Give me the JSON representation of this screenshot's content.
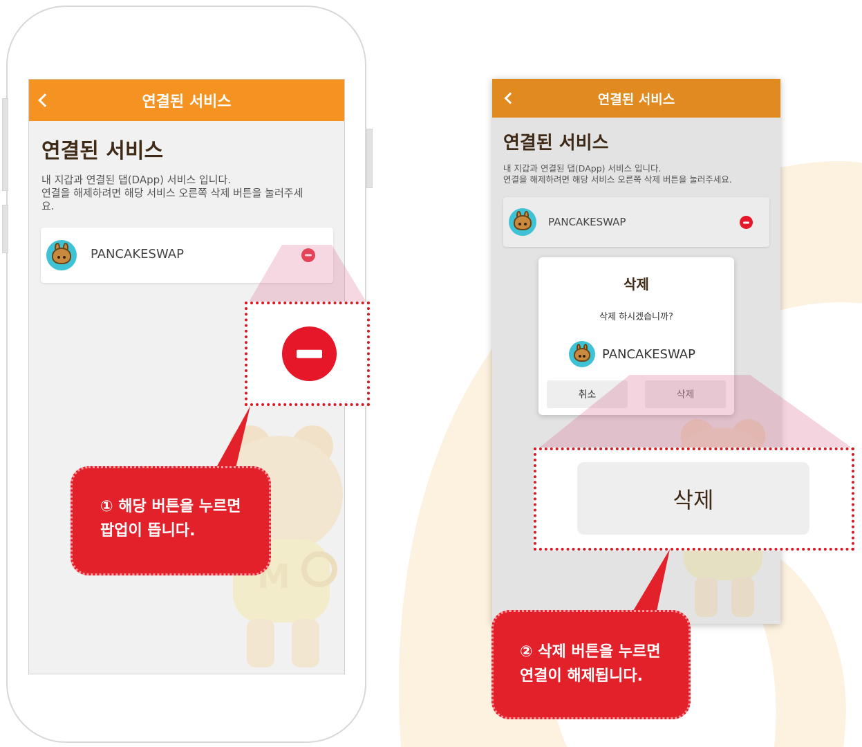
{
  "left_screen": {
    "appbar_title": "연결된 서비스",
    "page_title": "연결된 서비스",
    "description_line1": "내 지갑과 연결된 댑(DApp) 서비스 입니다.",
    "description_line2": "연결을 해제하려면 해당 서비스 오른쪽 삭제 버튼을 눌러주세",
    "description_line3": "요.",
    "service_name": "PANCAKESWAP"
  },
  "right_screen": {
    "appbar_title": "연결된 서비스",
    "page_title": "연결된 서비스",
    "description_line1": "내 지갑과 연결된 댑(DApp) 서비스 입니다.",
    "description_line2": "연결을 해제하려면 해당 서비스 오른쪽 삭제 버튼을 눌러주세요.",
    "service_name": "PANCAKESWAP"
  },
  "dialog": {
    "title": "삭제",
    "message": "삭제 하시겠습니까?",
    "service_name": "PANCAKESWAP",
    "cancel_label": "취소",
    "delete_label": "삭제"
  },
  "zoom": {
    "delete_label": "삭제"
  },
  "callouts": {
    "step1_line1": "① 해당 버튼을 누르면",
    "step1_line2": "팝업이 뜹니다.",
    "step2_line1": "② 삭제 버튼을 누르면",
    "step2_line2": "연결이 해제됩니다."
  },
  "colors": {
    "appbar": "#f59322",
    "delete_red": "#e51728",
    "callout_red": "#e3212b",
    "title_brown": "#3e2a16"
  },
  "icons": [
    "back-chevron-icon",
    "pancakeswap-logo-icon",
    "minus-circle-icon"
  ]
}
